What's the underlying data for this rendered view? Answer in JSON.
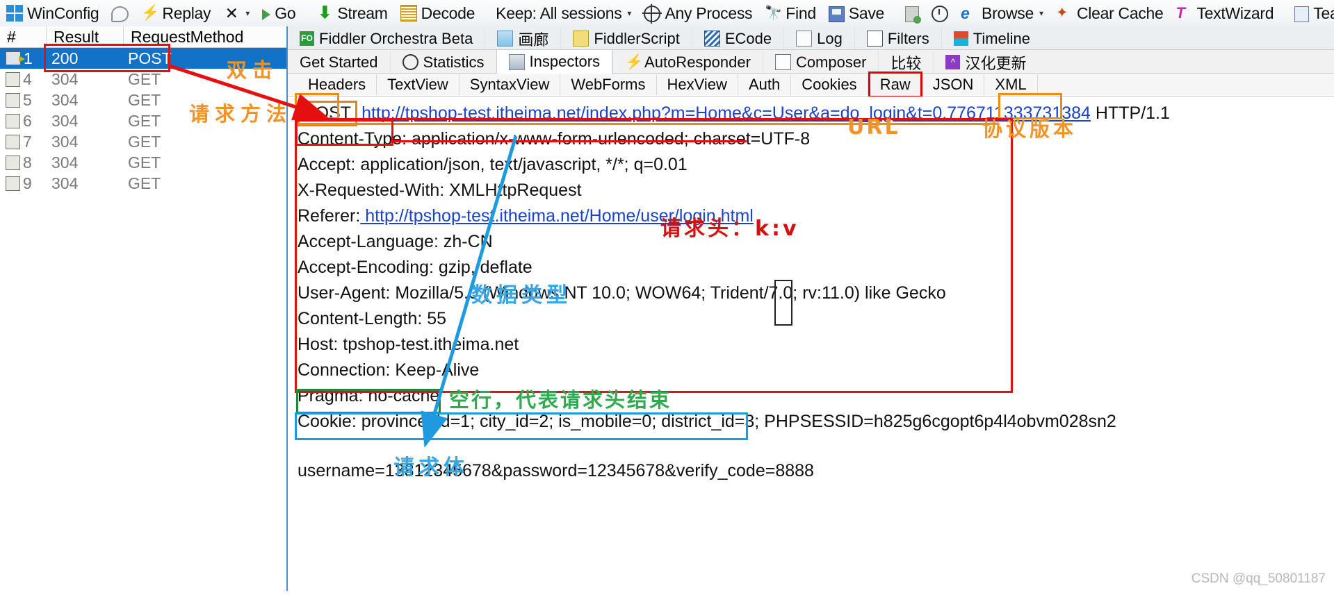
{
  "toolbar": {
    "items": [
      {
        "icon": "windows-icon",
        "label": "WinConfig"
      },
      {
        "icon": "comment-bubble-icon",
        "label": ""
      },
      {
        "icon": "replay-icon",
        "label": "Replay"
      },
      {
        "icon": "remove-x-icon",
        "label": "",
        "caret": "▾"
      },
      {
        "icon": "play-icon",
        "label": "Go"
      },
      {
        "icon": "stream-arrow-icon",
        "label": "Stream"
      },
      {
        "icon": "decode-icon",
        "label": "Decode"
      },
      {
        "icon": "",
        "label": "Keep: All sessions",
        "caret": "▾"
      },
      {
        "icon": "any-process-target-icon",
        "label": "Any Process"
      },
      {
        "icon": "find-binoculars-icon",
        "label": "Find"
      },
      {
        "icon": "save-icon",
        "label": "Save"
      },
      {
        "icon": "clipboard-icon",
        "label": ""
      },
      {
        "icon": "timer-icon",
        "label": ""
      },
      {
        "icon": "browser-ie-icon",
        "label": "Browse",
        "caret": "▾"
      },
      {
        "icon": "clear-cache-icon",
        "label": "Clear Cache"
      },
      {
        "icon": "textwizard-icon",
        "label": "TextWizard"
      },
      {
        "icon": "tearoff-icon",
        "label": "Tearoff"
      }
    ]
  },
  "sessions": {
    "columns": [
      "#",
      "Result",
      "RequestMethod"
    ],
    "rows": [
      {
        "num": "1",
        "result": "200",
        "method": "POST",
        "selected": true
      },
      {
        "num": "4",
        "result": "304",
        "method": "GET",
        "selected": false
      },
      {
        "num": "5",
        "result": "304",
        "method": "GET",
        "selected": false
      },
      {
        "num": "6",
        "result": "304",
        "method": "GET",
        "selected": false
      },
      {
        "num": "7",
        "result": "304",
        "method": "GET",
        "selected": false
      },
      {
        "num": "8",
        "result": "304",
        "method": "GET",
        "selected": false
      },
      {
        "num": "9",
        "result": "304",
        "method": "GET",
        "selected": false
      }
    ]
  },
  "right_panel": {
    "tabs_row1": [
      {
        "icon": "fiddler-orchestra-icon",
        "label": "Fiddler Orchestra Beta",
        "active": false
      },
      {
        "icon": "gallery-image-icon",
        "label": "画廊",
        "active": false
      },
      {
        "icon": "fiddlerscript-icon",
        "label": "FiddlerScript",
        "active": false
      },
      {
        "icon": "ecode-icon",
        "label": "ECode",
        "active": false
      },
      {
        "icon": "log-icon",
        "label": "Log",
        "active": false
      },
      {
        "icon": "filters-icon",
        "label": "Filters",
        "active": false
      },
      {
        "icon": "timeline-icon",
        "label": "Timeline",
        "active": false
      }
    ],
    "tabs_row2": [
      {
        "icon": "",
        "label": "Get Started",
        "active": false
      },
      {
        "icon": "statistics-clock-icon",
        "label": "Statistics",
        "active": false
      },
      {
        "icon": "inspectors-magnifier-icon",
        "label": "Inspectors",
        "active": true
      },
      {
        "icon": "autoresponder-bolt-icon",
        "label": "AutoResponder",
        "active": false
      },
      {
        "icon": "composer-icon",
        "label": "Composer",
        "active": false
      },
      {
        "icon": "",
        "label": "比较",
        "active": false
      },
      {
        "icon": "update-icon",
        "label": "汉化更新",
        "active": false
      }
    ],
    "sub_tabs": [
      {
        "label": "Headers",
        "highlighted": false
      },
      {
        "label": "TextView",
        "highlighted": false
      },
      {
        "label": "SyntaxView",
        "highlighted": false
      },
      {
        "label": "WebForms",
        "highlighted": false
      },
      {
        "label": "HexView",
        "highlighted": false
      },
      {
        "label": "Auth",
        "highlighted": false
      },
      {
        "label": "Cookies",
        "highlighted": false
      },
      {
        "label": "Raw",
        "highlighted": true
      },
      {
        "label": "JSON",
        "highlighted": false
      },
      {
        "label": "XML",
        "highlighted": false
      }
    ]
  },
  "raw": {
    "request_line": {
      "method": "POST",
      "url": "http://tpshop-test.itheima.net/index.php?m=Home&c=User&a=do_login&t=0.776711333731384",
      "version": "HTTP/1.1"
    },
    "headers": [
      {
        "name": "Content-Type:",
        "value": " application/x-www-form-urlencoded; charset=UTF-8",
        "link": false
      },
      {
        "name": "Accept:",
        "value": " application/json, text/javascript, */*; q=0.01",
        "link": false
      },
      {
        "name": "X-Requested-With:",
        "value": " XMLHttpRequest",
        "link": false
      },
      {
        "name": "Referer:",
        "value": " http://tpshop-test.itheima.net/Home/user/login.html",
        "link": true
      },
      {
        "name": "Accept-Language:",
        "value": " zh-CN",
        "link": false
      },
      {
        "name": "Accept-Encoding:",
        "value": " gzip, deflate",
        "link": false
      },
      {
        "name": "User-Agent:",
        "value": " Mozilla/5.0 (Windows NT 10.0; WOW64; Trident/7.0; rv:11.0) like Gecko",
        "link": false
      },
      {
        "name": "Content-Length:",
        "value": " 55",
        "link": false
      },
      {
        "name": "Host:",
        "value": " tpshop-test.itheima.net",
        "link": false
      },
      {
        "name": "Connection:",
        "value": " Keep-Alive",
        "link": false
      },
      {
        "name": "Pragma:",
        "value": " no-cache",
        "link": false
      },
      {
        "name": "Cookie:",
        "value": " province_id=1; city_id=2; is_mobile=0; district_id=3; PHPSESSID=h825g6cgopt6p4l4obvm028sn2",
        "link": false
      }
    ],
    "blank_line": "",
    "body": "username=13812345678&password=12345678&verify_code=8888"
  },
  "annotations": [
    {
      "id": "double-click",
      "text": "双击",
      "color": "#f0942a"
    },
    {
      "id": "request-method",
      "text": "请求方法",
      "color": "#f0942a"
    },
    {
      "id": "url-label",
      "text": "URL",
      "color": "#f0942a"
    },
    {
      "id": "protocol-version",
      "text": "协议版本",
      "color": "#f0942a"
    },
    {
      "id": "request-headers-kv",
      "text": "请求头：k:v",
      "color": "#d41111"
    },
    {
      "id": "data-type",
      "text": "数据类型",
      "color": "#39a6e3"
    },
    {
      "id": "blank-line-note",
      "text": "空行，代表请求头结束",
      "color": "#2faa4f"
    },
    {
      "id": "request-body",
      "text": "请求体",
      "color": "#39a6e3"
    }
  ],
  "watermark": "CSDN @qq_50801187"
}
